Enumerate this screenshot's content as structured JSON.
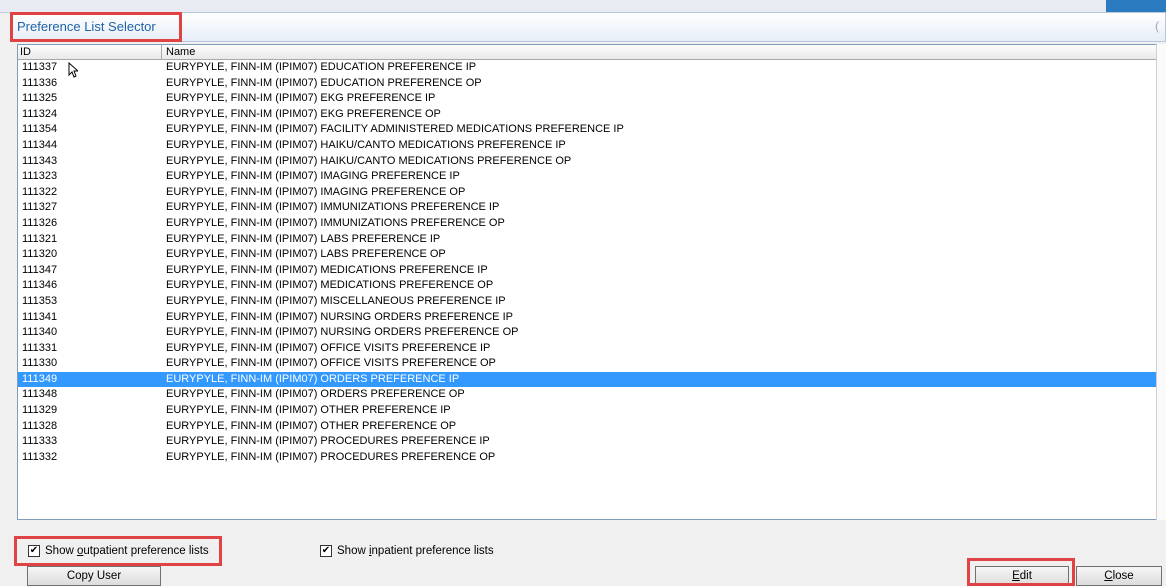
{
  "window": {
    "title": "Preference List Selector",
    "right_glyph": "("
  },
  "table": {
    "columns": {
      "id": "ID",
      "name": "Name"
    },
    "selected_index": 22,
    "rows": [
      {
        "id": "111337",
        "name": "EURYPYLE, FINN-IM (IPIM07) EDUCATION PREFERENCE IP"
      },
      {
        "id": "111336",
        "name": "EURYPYLE, FINN-IM (IPIM07) EDUCATION PREFERENCE OP"
      },
      {
        "id": "111325",
        "name": "EURYPYLE, FINN-IM (IPIM07) EKG PREFERENCE IP"
      },
      {
        "id": "111324",
        "name": "EURYPYLE, FINN-IM (IPIM07) EKG PREFERENCE OP"
      },
      {
        "id": "111354",
        "name": "EURYPYLE, FINN-IM (IPIM07) FACILITY ADMINISTERED MEDICATIONS PREFERENCE IP"
      },
      {
        "id": "111344",
        "name": "EURYPYLE, FINN-IM (IPIM07) HAIKU/CANTO MEDICATIONS PREFERENCE IP"
      },
      {
        "id": "111343",
        "name": "EURYPYLE, FINN-IM (IPIM07) HAIKU/CANTO MEDICATIONS PREFERENCE OP"
      },
      {
        "id": "111323",
        "name": "EURYPYLE, FINN-IM (IPIM07) IMAGING PREFERENCE IP"
      },
      {
        "id": "111322",
        "name": "EURYPYLE, FINN-IM (IPIM07) IMAGING PREFERENCE OP"
      },
      {
        "id": "111327",
        "name": "EURYPYLE, FINN-IM (IPIM07) IMMUNIZATIONS PREFERENCE IP"
      },
      {
        "id": "111326",
        "name": "EURYPYLE, FINN-IM (IPIM07) IMMUNIZATIONS PREFERENCE OP"
      },
      {
        "id": "111321",
        "name": "EURYPYLE, FINN-IM (IPIM07) LABS PREFERENCE IP"
      },
      {
        "id": "111320",
        "name": "EURYPYLE, FINN-IM (IPIM07) LABS PREFERENCE OP"
      },
      {
        "id": "111347",
        "name": "EURYPYLE, FINN-IM (IPIM07) MEDICATIONS PREFERENCE IP"
      },
      {
        "id": "111346",
        "name": "EURYPYLE, FINN-IM (IPIM07) MEDICATIONS PREFERENCE OP"
      },
      {
        "id": "111353",
        "name": "EURYPYLE, FINN-IM (IPIM07) MISCELLANEOUS PREFERENCE IP"
      },
      {
        "id": "111341",
        "name": "EURYPYLE, FINN-IM (IPIM07) NURSING ORDERS PREFERENCE IP"
      },
      {
        "id": "111340",
        "name": "EURYPYLE, FINN-IM (IPIM07) NURSING ORDERS PREFERENCE OP"
      },
      {
        "id": "111331",
        "name": "EURYPYLE, FINN-IM (IPIM07) OFFICE VISITS PREFERENCE IP"
      },
      {
        "id": "111330",
        "name": "EURYPYLE, FINN-IM (IPIM07) OFFICE VISITS PREFERENCE OP"
      },
      {
        "id": "111349",
        "name": "EURYPYLE, FINN-IM (IPIM07) ORDERS PREFERENCE IP"
      },
      {
        "id": "111348",
        "name": "EURYPYLE, FINN-IM (IPIM07) ORDERS PREFERENCE OP"
      },
      {
        "id": "111329",
        "name": "EURYPYLE, FINN-IM (IPIM07) OTHER PREFERENCE IP"
      },
      {
        "id": "111328",
        "name": "EURYPYLE, FINN-IM (IPIM07) OTHER PREFERENCE OP"
      },
      {
        "id": "111333",
        "name": "EURYPYLE, FINN-IM (IPIM07) PROCEDURES PREFERENCE IP"
      },
      {
        "id": "111332",
        "name": "EURYPYLE, FINN-IM (IPIM07) PROCEDURES PREFERENCE OP"
      }
    ]
  },
  "options": {
    "outpatient": {
      "prefix": "Show ",
      "accel": "o",
      "suffix": "utpatient preference lists",
      "checked": true
    },
    "inpatient": {
      "prefix": "Show ",
      "accel": "i",
      "suffix": "npatient preference lists",
      "checked": true
    },
    "check_glyph": "✔"
  },
  "buttons": {
    "copy_user": "Copy User",
    "edit_accel": "E",
    "edit_rest": "dit",
    "close_accel": "C",
    "close_rest": "lose"
  },
  "colors": {
    "selection": "#3399ff",
    "title": "#1f62a8",
    "highlight_box": "#e04343"
  }
}
